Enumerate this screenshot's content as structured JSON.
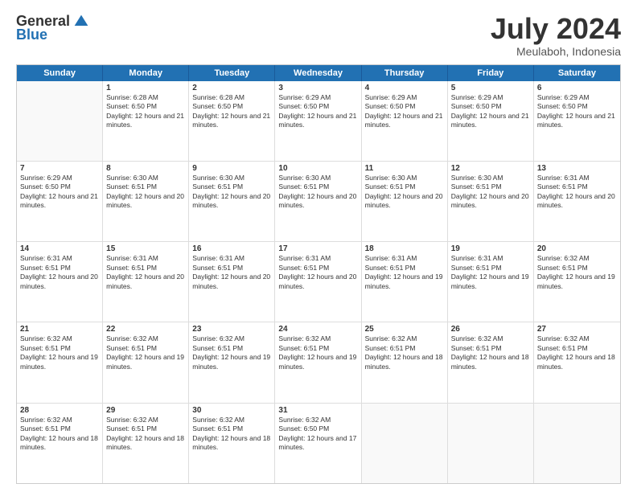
{
  "logo": {
    "general": "General",
    "blue": "Blue"
  },
  "title": "July 2024",
  "location": "Meulaboh, Indonesia",
  "days_of_week": [
    "Sunday",
    "Monday",
    "Tuesday",
    "Wednesday",
    "Thursday",
    "Friday",
    "Saturday"
  ],
  "weeks": [
    [
      {
        "day": "",
        "empty": true
      },
      {
        "day": "1",
        "sunrise": "6:28 AM",
        "sunset": "6:50 PM",
        "daylight": "12 hours and 21 minutes."
      },
      {
        "day": "2",
        "sunrise": "6:28 AM",
        "sunset": "6:50 PM",
        "daylight": "12 hours and 21 minutes."
      },
      {
        "day": "3",
        "sunrise": "6:29 AM",
        "sunset": "6:50 PM",
        "daylight": "12 hours and 21 minutes."
      },
      {
        "day": "4",
        "sunrise": "6:29 AM",
        "sunset": "6:50 PM",
        "daylight": "12 hours and 21 minutes."
      },
      {
        "day": "5",
        "sunrise": "6:29 AM",
        "sunset": "6:50 PM",
        "daylight": "12 hours and 21 minutes."
      },
      {
        "day": "6",
        "sunrise": "6:29 AM",
        "sunset": "6:50 PM",
        "daylight": "12 hours and 21 minutes."
      }
    ],
    [
      {
        "day": "7",
        "sunrise": "6:29 AM",
        "sunset": "6:50 PM",
        "daylight": "12 hours and 21 minutes."
      },
      {
        "day": "8",
        "sunrise": "6:30 AM",
        "sunset": "6:51 PM",
        "daylight": "12 hours and 20 minutes."
      },
      {
        "day": "9",
        "sunrise": "6:30 AM",
        "sunset": "6:51 PM",
        "daylight": "12 hours and 20 minutes."
      },
      {
        "day": "10",
        "sunrise": "6:30 AM",
        "sunset": "6:51 PM",
        "daylight": "12 hours and 20 minutes."
      },
      {
        "day": "11",
        "sunrise": "6:30 AM",
        "sunset": "6:51 PM",
        "daylight": "12 hours and 20 minutes."
      },
      {
        "day": "12",
        "sunrise": "6:30 AM",
        "sunset": "6:51 PM",
        "daylight": "12 hours and 20 minutes."
      },
      {
        "day": "13",
        "sunrise": "6:31 AM",
        "sunset": "6:51 PM",
        "daylight": "12 hours and 20 minutes."
      }
    ],
    [
      {
        "day": "14",
        "sunrise": "6:31 AM",
        "sunset": "6:51 PM",
        "daylight": "12 hours and 20 minutes."
      },
      {
        "day": "15",
        "sunrise": "6:31 AM",
        "sunset": "6:51 PM",
        "daylight": "12 hours and 20 minutes."
      },
      {
        "day": "16",
        "sunrise": "6:31 AM",
        "sunset": "6:51 PM",
        "daylight": "12 hours and 20 minutes."
      },
      {
        "day": "17",
        "sunrise": "6:31 AM",
        "sunset": "6:51 PM",
        "daylight": "12 hours and 20 minutes."
      },
      {
        "day": "18",
        "sunrise": "6:31 AM",
        "sunset": "6:51 PM",
        "daylight": "12 hours and 19 minutes."
      },
      {
        "day": "19",
        "sunrise": "6:31 AM",
        "sunset": "6:51 PM",
        "daylight": "12 hours and 19 minutes."
      },
      {
        "day": "20",
        "sunrise": "6:32 AM",
        "sunset": "6:51 PM",
        "daylight": "12 hours and 19 minutes."
      }
    ],
    [
      {
        "day": "21",
        "sunrise": "6:32 AM",
        "sunset": "6:51 PM",
        "daylight": "12 hours and 19 minutes."
      },
      {
        "day": "22",
        "sunrise": "6:32 AM",
        "sunset": "6:51 PM",
        "daylight": "12 hours and 19 minutes."
      },
      {
        "day": "23",
        "sunrise": "6:32 AM",
        "sunset": "6:51 PM",
        "daylight": "12 hours and 19 minutes."
      },
      {
        "day": "24",
        "sunrise": "6:32 AM",
        "sunset": "6:51 PM",
        "daylight": "12 hours and 19 minutes."
      },
      {
        "day": "25",
        "sunrise": "6:32 AM",
        "sunset": "6:51 PM",
        "daylight": "12 hours and 18 minutes."
      },
      {
        "day": "26",
        "sunrise": "6:32 AM",
        "sunset": "6:51 PM",
        "daylight": "12 hours and 18 minutes."
      },
      {
        "day": "27",
        "sunrise": "6:32 AM",
        "sunset": "6:51 PM",
        "daylight": "12 hours and 18 minutes."
      }
    ],
    [
      {
        "day": "28",
        "sunrise": "6:32 AM",
        "sunset": "6:51 PM",
        "daylight": "12 hours and 18 minutes."
      },
      {
        "day": "29",
        "sunrise": "6:32 AM",
        "sunset": "6:51 PM",
        "daylight": "12 hours and 18 minutes."
      },
      {
        "day": "30",
        "sunrise": "6:32 AM",
        "sunset": "6:51 PM",
        "daylight": "12 hours and 18 minutes."
      },
      {
        "day": "31",
        "sunrise": "6:32 AM",
        "sunset": "6:50 PM",
        "daylight": "12 hours and 17 minutes."
      },
      {
        "day": "",
        "empty": true
      },
      {
        "day": "",
        "empty": true
      },
      {
        "day": "",
        "empty": true
      }
    ]
  ]
}
